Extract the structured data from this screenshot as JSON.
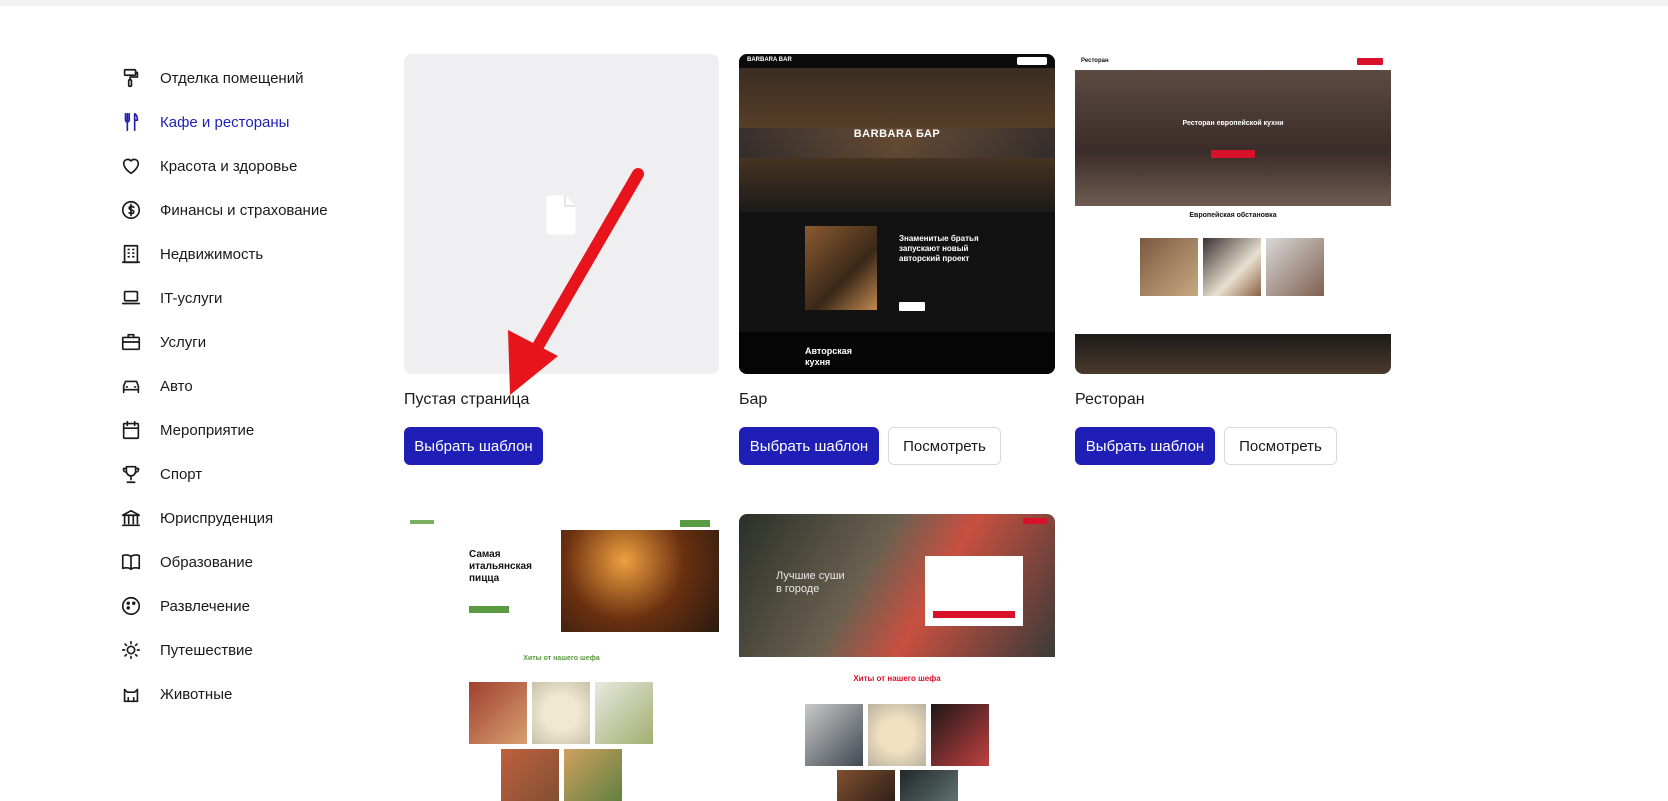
{
  "sidebar": {
    "items": [
      {
        "label": "Отделка помещений",
        "icon": "paint-roller-icon"
      },
      {
        "label": "Кафе и рестораны",
        "icon": "fork-knife-icon",
        "active": true
      },
      {
        "label": "Красота и здоровье",
        "icon": "heart-icon"
      },
      {
        "label": "Финансы и страхование",
        "icon": "dollar-circle-icon"
      },
      {
        "label": "Недвижимость",
        "icon": "building-icon"
      },
      {
        "label": "IT-услуги",
        "icon": "laptop-icon"
      },
      {
        "label": "Услуги",
        "icon": "briefcase-icon"
      },
      {
        "label": "Авто",
        "icon": "car-icon"
      },
      {
        "label": "Мероприятие",
        "icon": "calendar-icon"
      },
      {
        "label": "Спорт",
        "icon": "trophy-icon"
      },
      {
        "label": "Юриспруденция",
        "icon": "bank-icon"
      },
      {
        "label": "Образование",
        "icon": "book-icon"
      },
      {
        "label": "Развлечение",
        "icon": "palette-icon"
      },
      {
        "label": "Путешествие",
        "icon": "sun-icon"
      },
      {
        "label": "Животные",
        "icon": "cat-icon"
      }
    ]
  },
  "templates": [
    {
      "title": "Пустая страница",
      "select_label": "Выбрать шаблон"
    },
    {
      "title": "Бар",
      "select_label": "Выбрать шаблон",
      "view_label": "Посмотреть",
      "preview": {
        "brand": "BARBARA BAR",
        "hero": "BARBARA БАР",
        "news": "Знаменитые братья запускают новый авторский проект",
        "section": "Авторская кухня"
      }
    },
    {
      "title": "Ресторан",
      "select_label": "Выбрать шаблон",
      "view_label": "Посмотреть",
      "preview": {
        "brand": "Ресторан",
        "hero": "Ресторан европейской кухни",
        "section": "Европейская обстановка"
      }
    },
    {
      "preview": {
        "hero": "Самая итальянская пицца",
        "section": "Хиты от нашего шефа"
      }
    },
    {
      "preview": {
        "hero": "Лучшие суши в городе",
        "section": "Хиты от нашего шефа"
      }
    }
  ],
  "colors": {
    "accent": "#1f1fb8",
    "arrow": "#e8141b"
  }
}
